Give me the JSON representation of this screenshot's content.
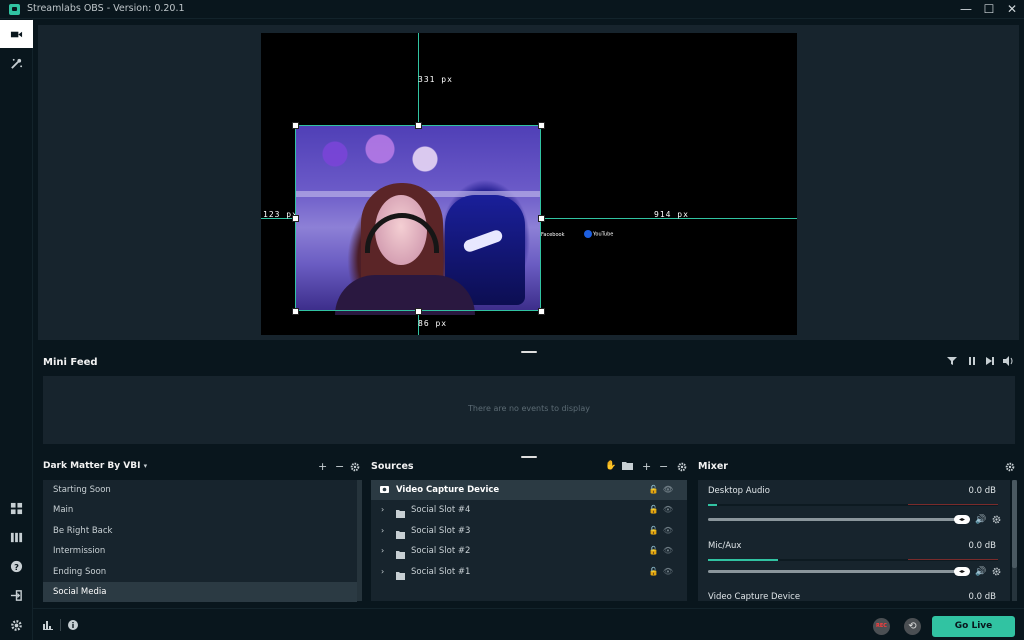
{
  "window": {
    "title": "Streamlabs OBS - Version: 0.20.1",
    "minimize_glyph": "—",
    "maximize_glyph": "☐",
    "close_glyph": "✕"
  },
  "leftnav": {
    "items": [
      "studio-mode-icon",
      "themes-icon",
      "layout-icon",
      "dock-icon",
      "help-icon",
      "logout-icon",
      "settings-icon"
    ]
  },
  "editor": {
    "dimension_top": "331 px",
    "dimension_left": "123 px",
    "dimension_right": "914 px",
    "dimension_bottom": "86 px",
    "social_facebook": "Facebook",
    "social_youtube": "YouTube"
  },
  "minifeed": {
    "title": "Mini Feed",
    "empty_message": "There are no events to display"
  },
  "scenes": {
    "collection": "Dark Matter By VBI",
    "items": [
      "Starting Soon",
      "Main",
      "Be Right Back",
      "Intermission",
      "Ending Soon",
      "Social Media"
    ],
    "selected": "Social Media"
  },
  "sources": {
    "title": "Sources",
    "items": [
      "Video Capture Device",
      "Social Slot #4",
      "Social Slot #3",
      "Social Slot #2",
      "Social Slot #1"
    ],
    "selected": "Video Capture Device"
  },
  "mixer": {
    "title": "Mixer",
    "channels": [
      {
        "name": "Desktop Audio",
        "value": "0.0 dB",
        "level": 0.03
      },
      {
        "name": "Mic/Aux",
        "value": "0.0 dB",
        "level": 0.24
      },
      {
        "name": "Video Capture Device",
        "value": "0.0 dB",
        "level": 0
      }
    ]
  },
  "footer": {
    "rec_label": "REC",
    "go_live_label": "Go Live"
  },
  "colors": {
    "accent": "#31c3a2",
    "background": "#09161d",
    "panel": "#17242d"
  }
}
